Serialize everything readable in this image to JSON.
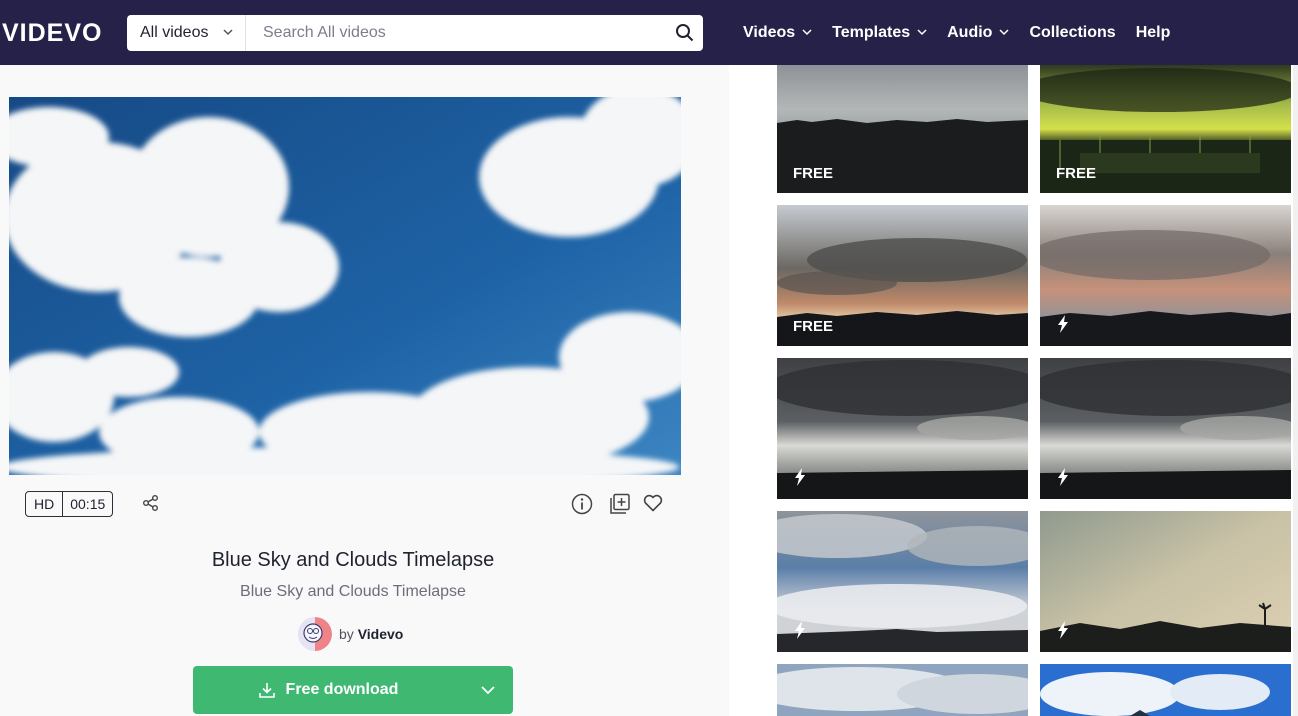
{
  "header": {
    "logo": "VIDEVO",
    "category_select": "All videos",
    "search_placeholder": "Search All videos",
    "nav": [
      {
        "label": "Videos",
        "has_dropdown": true
      },
      {
        "label": "Templates",
        "has_dropdown": true
      },
      {
        "label": "Audio",
        "has_dropdown": true
      },
      {
        "label": "Collections",
        "has_dropdown": false
      },
      {
        "label": "Help",
        "has_dropdown": false
      }
    ]
  },
  "video": {
    "quality": "HD",
    "duration": "00:15",
    "title": "Blue Sky and Clouds Timelapse",
    "subtitle": "Blue Sky and Clouds Timelapse",
    "author_prefix": "by",
    "author": "Videvo",
    "download_label": "Free download"
  },
  "related": [
    {
      "badge": "FREE",
      "icon": "none"
    },
    {
      "badge": "FREE",
      "icon": "none"
    },
    {
      "badge": "FREE",
      "icon": "none"
    },
    {
      "badge": "",
      "icon": "bolt-icon"
    },
    {
      "badge": "",
      "icon": "bolt-icon"
    },
    {
      "badge": "",
      "icon": "bolt-icon"
    },
    {
      "badge": "",
      "icon": "bolt-icon"
    },
    {
      "badge": "",
      "icon": "bolt-icon"
    },
    {
      "badge": "",
      "icon": "none"
    },
    {
      "badge": "",
      "icon": "none"
    }
  ],
  "colors": {
    "header_bg": "#252148",
    "download_green": "#3fb871",
    "panel_bg": "#f9f9fa"
  }
}
